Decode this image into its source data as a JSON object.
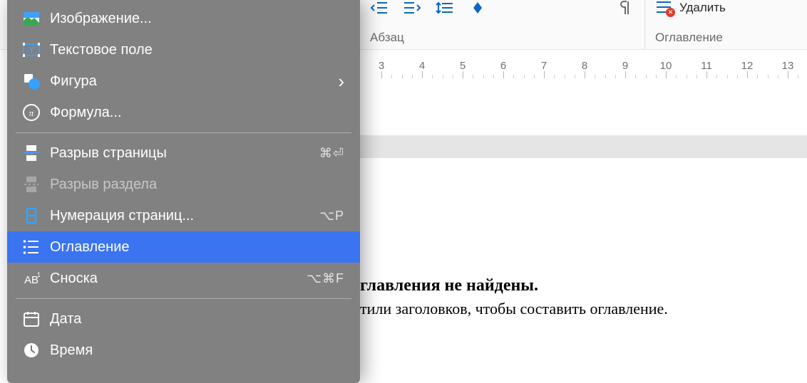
{
  "toolbar": {
    "paragraph_label": "Абзац",
    "toc_label": "Оглавление",
    "delete_label": "Удалить"
  },
  "ruler": {
    "start": 3,
    "end": 13,
    "nums": [
      3,
      4,
      5,
      6,
      7,
      8,
      9,
      10,
      11,
      12,
      13
    ]
  },
  "document": {
    "heading_fragment": "главления не найдены.",
    "body_fragment": "тили заголовков, чтобы составить оглавление."
  },
  "menu": {
    "items": [
      {
        "id": "image",
        "label": "Изображение...",
        "icon": "image-icon",
        "shortcut": "",
        "submenu": false,
        "disabled": false,
        "highlight": false
      },
      {
        "id": "textbox",
        "label": "Текстовое поле",
        "icon": "textbox-icon",
        "shortcut": "",
        "submenu": false,
        "disabled": false,
        "highlight": false
      },
      {
        "id": "shape",
        "label": "Фигура",
        "icon": "shape-icon",
        "shortcut": "",
        "submenu": true,
        "disabled": false,
        "highlight": false
      },
      {
        "id": "formula",
        "label": "Формула...",
        "icon": "formula-icon",
        "shortcut": "",
        "submenu": false,
        "disabled": false,
        "highlight": false
      },
      {
        "separator": true
      },
      {
        "id": "pagebreak",
        "label": "Разрыв страницы",
        "icon": "pagebreak-icon",
        "shortcut": "⌘⏎",
        "submenu": false,
        "disabled": false,
        "highlight": false
      },
      {
        "id": "sectionbreak",
        "label": "Разрыв раздела",
        "icon": "sectionbreak-icon",
        "shortcut": "",
        "submenu": false,
        "disabled": true,
        "highlight": false
      },
      {
        "id": "pagenum",
        "label": "Нумерация страниц...",
        "icon": "pagenum-icon",
        "shortcut": "⌥P",
        "submenu": false,
        "disabled": false,
        "highlight": false
      },
      {
        "id": "toc",
        "label": "Оглавление",
        "icon": "toc-icon",
        "shortcut": "",
        "submenu": false,
        "disabled": false,
        "highlight": true
      },
      {
        "id": "footnote",
        "label": "Сноска",
        "icon": "footnote-icon",
        "shortcut": "⌥⌘F",
        "submenu": false,
        "disabled": false,
        "highlight": false
      },
      {
        "separator": true
      },
      {
        "id": "date",
        "label": "Дата",
        "icon": "date-icon",
        "shortcut": "",
        "submenu": false,
        "disabled": false,
        "highlight": false
      },
      {
        "id": "time",
        "label": "Время",
        "icon": "time-icon",
        "shortcut": "",
        "submenu": false,
        "disabled": false,
        "highlight": false
      }
    ]
  }
}
